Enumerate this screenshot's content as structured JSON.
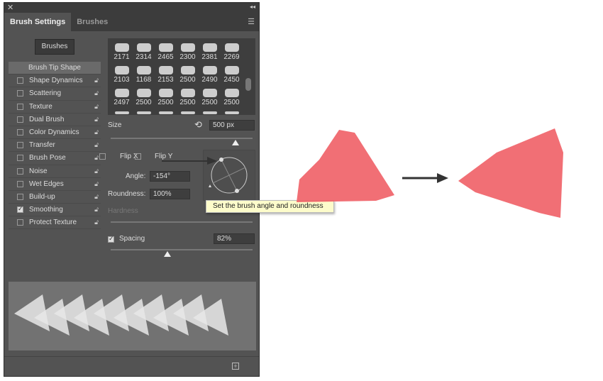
{
  "panel": {
    "close_icon": "close-icon",
    "collapse_icon": "double-chevron-icon",
    "tabs": [
      {
        "label": "Brush Settings",
        "active": true
      },
      {
        "label": "Brushes",
        "active": false
      }
    ],
    "brushes_button": "Brushes",
    "items": [
      {
        "label": "Brush Tip Shape",
        "selected": true
      },
      {
        "label": "Shape Dynamics",
        "checked": false
      },
      {
        "label": "Scattering",
        "checked": false
      },
      {
        "label": "Texture",
        "checked": false
      },
      {
        "label": "Dual Brush",
        "checked": false
      },
      {
        "label": "Color Dynamics",
        "checked": false
      },
      {
        "label": "Transfer",
        "checked": false
      },
      {
        "label": "Brush Pose",
        "checked": false
      },
      {
        "label": "Noise",
        "checked": false
      },
      {
        "label": "Wet Edges",
        "checked": false
      },
      {
        "label": "Build-up",
        "checked": false
      },
      {
        "label": "Smoothing",
        "checked": true
      },
      {
        "label": "Protect Texture",
        "checked": false
      }
    ],
    "brush_sizes": [
      "2171",
      "2314",
      "2465",
      "2300",
      "2381",
      "2269",
      "2103",
      "1168",
      "2153",
      "2500",
      "2490",
      "2450",
      "2497",
      "2500",
      "2500",
      "2500",
      "2500",
      "2500"
    ],
    "size_label": "Size",
    "size_value": "500 px",
    "size_fraction": 0.88,
    "flip_x": "Flip X",
    "flip_y": "Flip Y",
    "angle_label": "Angle:",
    "angle_value": "-154°",
    "roundness_label": "Roundness:",
    "roundness_value": "100%",
    "hardness_label": "Hardness",
    "spacing_label": "Spacing",
    "spacing_checked": true,
    "spacing_value": "82%",
    "spacing_fraction": 0.4,
    "tooltip": "Set the brush angle and roundness"
  },
  "colors": {
    "brush_red": "#ef5f66",
    "panel_bg": "#535353"
  }
}
